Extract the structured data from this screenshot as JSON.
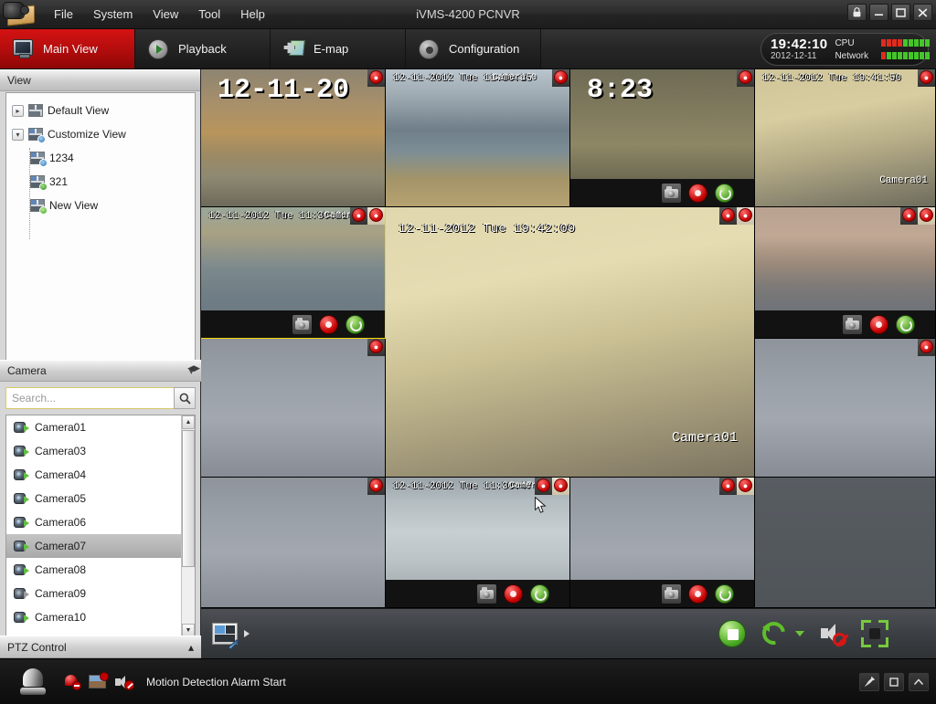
{
  "window": {
    "title": "iVMS-4200 PCNVR",
    "controls": [
      {
        "name": "lock",
        "glyph": "lock-icon"
      },
      {
        "name": "minimize",
        "glyph": "minimize-icon"
      },
      {
        "name": "maximize",
        "glyph": "maximize-icon"
      },
      {
        "name": "close",
        "glyph": "close-icon"
      }
    ]
  },
  "menubar": {
    "items": [
      {
        "label": "File"
      },
      {
        "label": "System"
      },
      {
        "label": "View"
      },
      {
        "label": "Tool"
      },
      {
        "label": "Help"
      }
    ]
  },
  "tabs": [
    {
      "label": "Main View",
      "icon": "monitor-icon",
      "active": true
    },
    {
      "label": "Playback",
      "icon": "play-circle-icon",
      "active": false
    },
    {
      "label": "E-map",
      "icon": "map-icon",
      "active": false
    },
    {
      "label": "Configuration",
      "icon": "gear-icon",
      "active": false
    }
  ],
  "clock": {
    "time": "19:42:10",
    "date": "2012-12-11",
    "cpu_label": "CPU",
    "network_label": "Network",
    "cpu_bars": 9,
    "cpu_red_bars": 4,
    "network_bars": 9,
    "network_red_bars": 1
  },
  "view_panel": {
    "header": "View",
    "tree": [
      {
        "label": "Default View",
        "icon": "grid-view-icon",
        "expanded": false,
        "level": 0
      },
      {
        "label": "Customize View",
        "icon": "custom-view-icon",
        "expanded": true,
        "level": 0
      },
      {
        "label": "1234",
        "icon": "view-user-icon",
        "level": 1
      },
      {
        "label": "321",
        "icon": "view-ok-icon",
        "level": 1
      },
      {
        "label": "New View",
        "icon": "view-add-icon",
        "level": 1
      }
    ]
  },
  "camera_panel": {
    "header": "Camera",
    "search_placeholder": "Search...",
    "search_value": "",
    "cameras": [
      {
        "label": "Camera01",
        "online": true,
        "selected": false
      },
      {
        "label": "Camera03",
        "online": true,
        "selected": false
      },
      {
        "label": "Camera04",
        "online": true,
        "selected": false
      },
      {
        "label": "Camera05",
        "online": true,
        "selected": false
      },
      {
        "label": "Camera06",
        "online": true,
        "selected": false
      },
      {
        "label": "Camera07",
        "online": true,
        "selected": true
      },
      {
        "label": "Camera08",
        "online": true,
        "selected": false
      },
      {
        "label": "Camera09",
        "online": false,
        "selected": false
      },
      {
        "label": "Camera10",
        "online": true,
        "selected": false
      }
    ]
  },
  "ptz_panel": {
    "header": "PTZ Control",
    "expanded": false
  },
  "video_grid": {
    "layout": "1+12",
    "cells": [
      {
        "id": "r1c1",
        "timestamp": "12-11-20",
        "timestamp_style": "big",
        "camera_label": "",
        "alarms": 1,
        "controls": false,
        "selected": false,
        "scene": "road-autumn"
      },
      {
        "id": "r1c2",
        "timestamp": "12-11-2012 Tue 11:30:15",
        "camera_label": "Camera 0",
        "alarms": 1,
        "controls": false,
        "selected": false,
        "scene": "marina-house"
      },
      {
        "id": "r1c3",
        "timestamp": "8:23",
        "timestamp_style": "big",
        "camera_label": "",
        "alarms": 1,
        "controls": true,
        "selected": false,
        "scene": "truck-field"
      },
      {
        "id": "r1c4",
        "timestamp": "12-11-2012 Tue 19:41:50",
        "camera_label": "Camera01",
        "alarms": 1,
        "controls": false,
        "selected": false,
        "scene": "room-yellow"
      },
      {
        "id": "r2c1",
        "timestamp": "12-11-2012 Tue 11:30:21",
        "camera_label": "Camer",
        "alarms": 2,
        "controls": true,
        "selected": true,
        "scene": "dock-water"
      },
      {
        "id": "center",
        "timestamp": "12-11-2012 Tue 19:42:09",
        "camera_label": "Camera01",
        "alarms": 2,
        "controls": false,
        "selected": false,
        "scene": "room-large"
      },
      {
        "id": "r2c4",
        "timestamp": "",
        "camera_label": "",
        "alarms": 2,
        "controls": true,
        "selected": false,
        "scene": "blur-wood"
      },
      {
        "id": "r3c1",
        "timestamp": "",
        "camera_label": "",
        "alarms": 1,
        "controls": false,
        "selected": false,
        "scene": "grey-water"
      },
      {
        "id": "r3c4",
        "timestamp": "",
        "camera_label": "",
        "alarms": 1,
        "controls": false,
        "selected": false,
        "scene": "grey-water"
      },
      {
        "id": "r4c1",
        "timestamp": "",
        "camera_label": "",
        "alarms": 1,
        "controls": false,
        "selected": false,
        "scene": "grey-water"
      },
      {
        "id": "r4c2",
        "timestamp": "12-11-2012 Tue 11:30:47",
        "camera_label": "Camer",
        "alarms": 2,
        "controls": true,
        "selected": false,
        "scene": "snow-path"
      },
      {
        "id": "r4c3",
        "timestamp": "",
        "camera_label": "",
        "alarms": 2,
        "controls": true,
        "selected": false,
        "scene": "grey-water"
      },
      {
        "id": "r4c4",
        "timestamp": "",
        "camera_label": "",
        "alarms": 0,
        "controls": false,
        "selected": false,
        "scene": "empty"
      }
    ]
  },
  "bottom_toolbar": {
    "layout_button": "layout-edit-icon",
    "expand_arrow": "triangle-right-icon",
    "buttons": [
      {
        "name": "stop-all-button",
        "icon": "stop-icon"
      },
      {
        "name": "auto-switch-button",
        "icon": "loop-icon"
      },
      {
        "name": "auto-switch-dropdown",
        "icon": "triangle-down-icon"
      },
      {
        "name": "mute-button",
        "icon": "mute-speaker-icon"
      },
      {
        "name": "fullscreen-button",
        "icon": "fullscreen-icon"
      }
    ]
  },
  "statusbar": {
    "alarm_icon": "siren-icon",
    "icons": [
      {
        "name": "alarm-bell-off-icon"
      },
      {
        "name": "picture-alarm-icon"
      },
      {
        "name": "sound-alarm-off-icon"
      }
    ],
    "message": "Motion Detection Alarm Start",
    "right_buttons": [
      {
        "name": "pin-button",
        "icon": "pin-icon"
      },
      {
        "name": "window-button",
        "icon": "square-icon"
      },
      {
        "name": "collapse-button",
        "icon": "chevron-up-icon"
      }
    ]
  }
}
